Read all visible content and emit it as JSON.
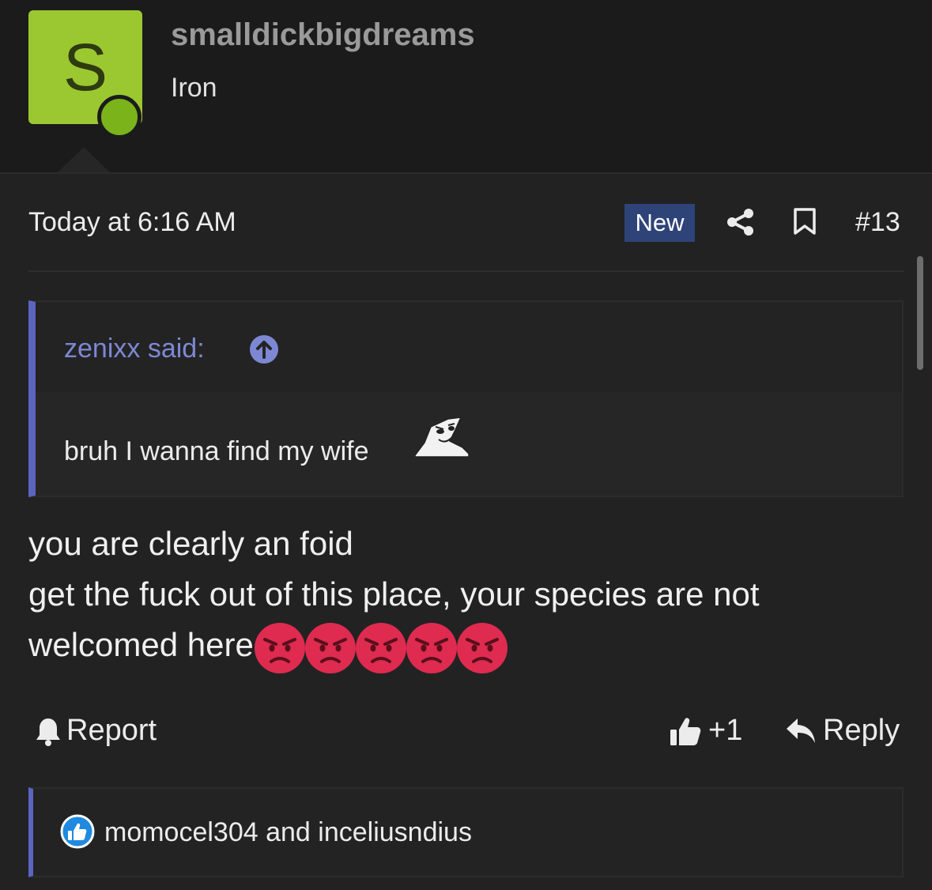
{
  "user": {
    "avatar_letter": "S",
    "avatar_color": "#9bc831",
    "online_color": "#7bb31a",
    "name": "smalldickbigdreams",
    "title": "Iron"
  },
  "post": {
    "date": "Today at 6:16 AM",
    "badge": "New",
    "number": "#13",
    "share_icon": "share-icon",
    "bookmark_icon": "bookmark-icon"
  },
  "quote": {
    "author": "zenixx said:",
    "text": "bruh I wanna find my wife",
    "accent": "#5b64bf",
    "author_color": "#7d88d3"
  },
  "message": {
    "lines": [
      "you are clearly an foid",
      "get the fuck out of this place, your species are not",
      "welcomed here"
    ],
    "emoji_name": "angry-face",
    "emoji_color": "#de2b4f"
  },
  "actions": {
    "report": "Report",
    "like": "+1",
    "reply": "Reply"
  },
  "reactions": {
    "text": "momocel304 and inceliusndius",
    "badge_color": "#1f8ae0"
  }
}
